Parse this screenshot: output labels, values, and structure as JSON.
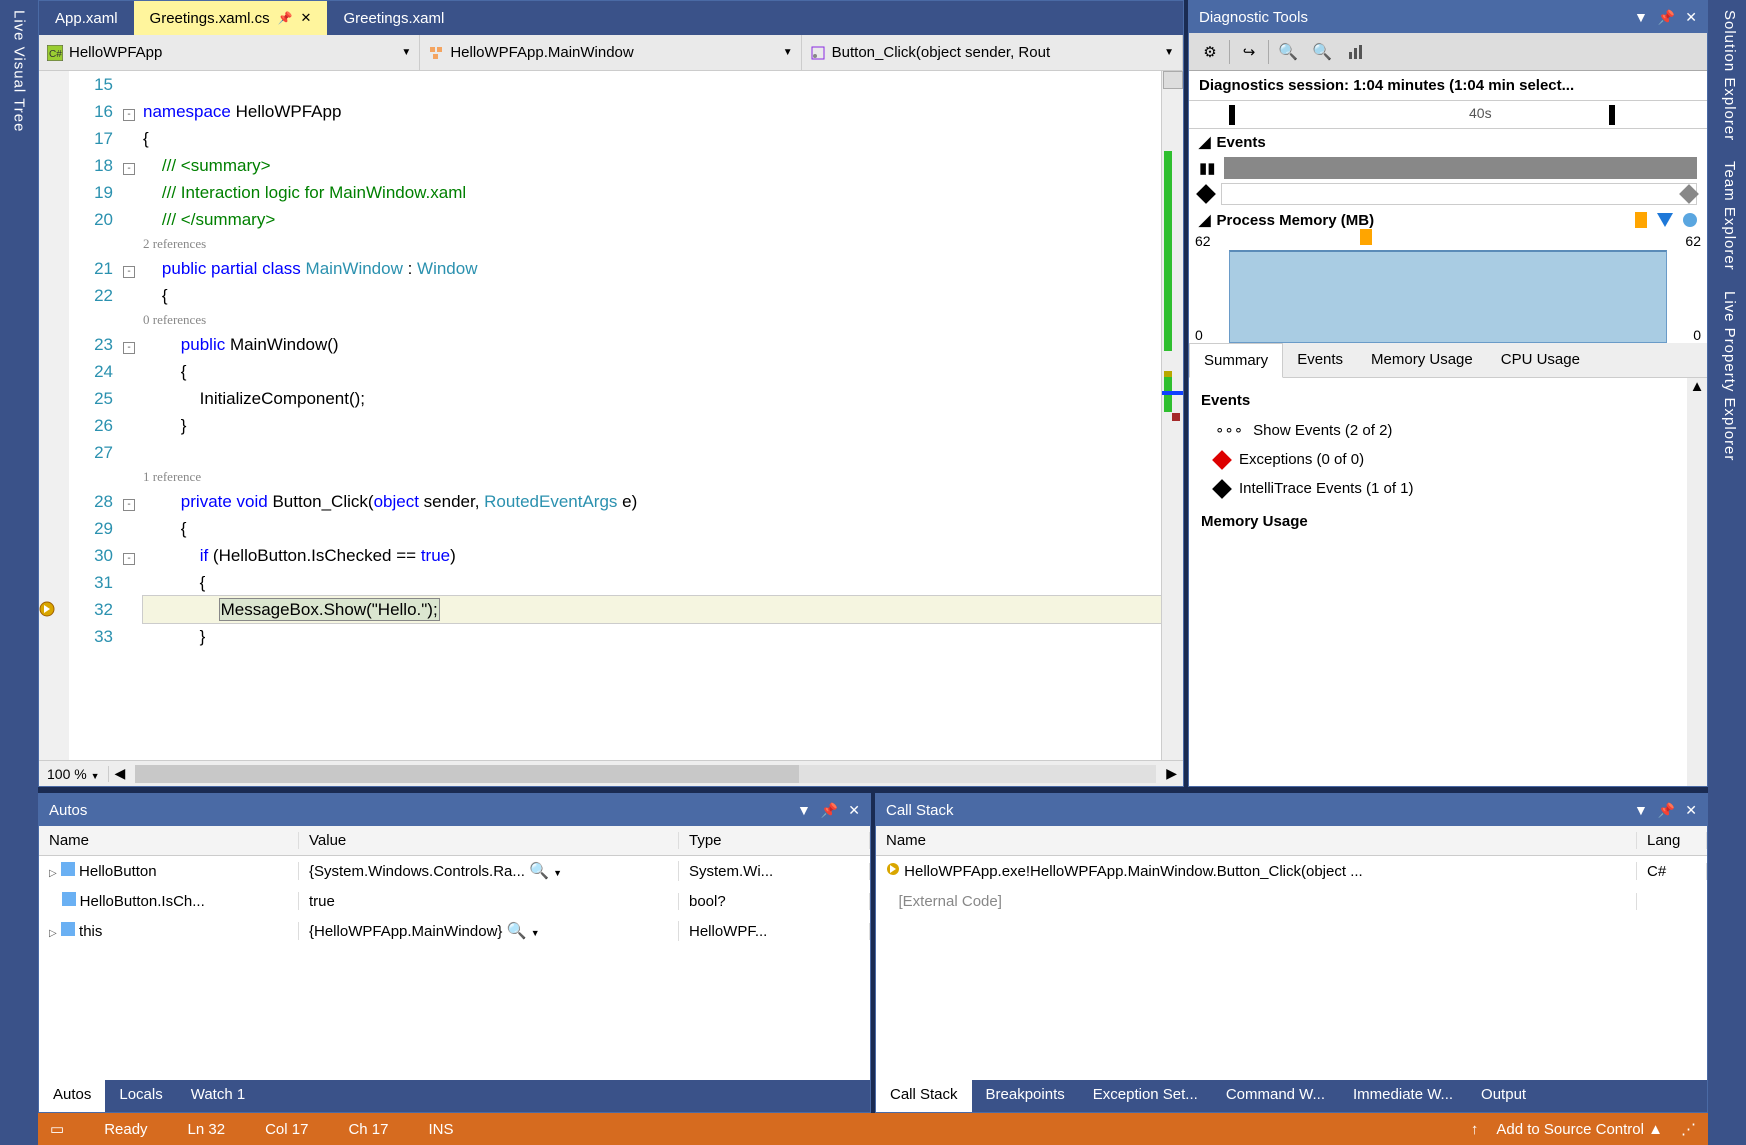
{
  "leftRail": "Live Visual Tree",
  "rightRail": [
    "Solution Explorer",
    "Team Explorer",
    "Live Property Explorer"
  ],
  "tabs": [
    {
      "label": "App.xaml",
      "active": false
    },
    {
      "label": "Greetings.xaml.cs",
      "active": true,
      "pinned": true
    },
    {
      "label": "Greetings.xaml",
      "active": false
    }
  ],
  "nav": {
    "namespace": "HelloWPFApp",
    "class": "HelloWPFApp.MainWindow",
    "member": "Button_Click(object sender, Rout"
  },
  "code": {
    "lines": [
      {
        "n": 15,
        "txt": ""
      },
      {
        "n": 16,
        "fold": "-",
        "txt": "namespace HelloWPFApp",
        "tokens": [
          [
            "kw",
            "namespace"
          ],
          [
            "",
            " HelloWPFApp"
          ]
        ]
      },
      {
        "n": 17,
        "txt": "{"
      },
      {
        "n": 18,
        "fold": "-",
        "txt": "    /// <summary>",
        "tokens": [
          [
            "",
            "    "
          ],
          [
            "comment",
            "/// <summary>"
          ]
        ]
      },
      {
        "n": 19,
        "txt": "    /// Interaction logic for MainWindow.xaml",
        "tokens": [
          [
            "",
            "    "
          ],
          [
            "comment",
            "/// Interaction logic for MainWindow.xaml"
          ]
        ]
      },
      {
        "n": 20,
        "txt": "    /// </summary>",
        "tokens": [
          [
            "",
            "    "
          ],
          [
            "comment",
            "/// </summary>"
          ]
        ]
      },
      {
        "ref": "2 references"
      },
      {
        "n": 21,
        "fold": "-",
        "tokens": [
          [
            "",
            "    "
          ],
          [
            "kw",
            "public partial class"
          ],
          [
            "",
            " "
          ],
          [
            "type",
            "MainWindow"
          ],
          [
            "",
            " : "
          ],
          [
            "type",
            "Window"
          ]
        ]
      },
      {
        "n": 22,
        "txt": "    {"
      },
      {
        "ref": "0 references"
      },
      {
        "n": 23,
        "fold": "-",
        "tokens": [
          [
            "",
            "        "
          ],
          [
            "kw",
            "public"
          ],
          [
            "",
            " MainWindow()"
          ]
        ]
      },
      {
        "n": 24,
        "txt": "        {"
      },
      {
        "n": 25,
        "txt": "            InitializeComponent();"
      },
      {
        "n": 26,
        "txt": "        }"
      },
      {
        "n": 27,
        "txt": ""
      },
      {
        "ref": "1 reference"
      },
      {
        "n": 28,
        "fold": "-",
        "tokens": [
          [
            "",
            "        "
          ],
          [
            "kw",
            "private void"
          ],
          [
            "",
            " Button_Click("
          ],
          [
            "kw",
            "object"
          ],
          [
            "",
            " sender, "
          ],
          [
            "type",
            "RoutedEventArgs"
          ],
          [
            "",
            " e)"
          ]
        ]
      },
      {
        "n": 29,
        "txt": "        {"
      },
      {
        "n": 30,
        "fold": "-",
        "tokens": [
          [
            "",
            "            "
          ],
          [
            "kw",
            "if"
          ],
          [
            "",
            " (HelloButton.IsChecked == "
          ],
          [
            "kw",
            "true"
          ],
          [
            "",
            ")"
          ]
        ]
      },
      {
        "n": 31,
        "txt": "            {"
      },
      {
        "n": 32,
        "bp": true,
        "highlight": true,
        "tokens": [
          [
            "",
            "                "
          ],
          [
            "sel",
            "MessageBox.Show(\"Hello.\");"
          ]
        ]
      },
      {
        "n": 33,
        "txt": "            }"
      }
    ],
    "zoom": "100 %"
  },
  "diag": {
    "title": "Diagnostic Tools",
    "session": "Diagnostics session: 1:04 minutes (1:04 min select...",
    "timeLabel": "40s",
    "eventsHeader": "Events",
    "memHeader": "Process Memory (MB)",
    "memMax": "62",
    "memMin": "0",
    "tabs": [
      "Summary",
      "Events",
      "Memory Usage",
      "CPU Usage"
    ],
    "activeTab": "Summary",
    "content": {
      "eventsTitle": "Events",
      "items": [
        {
          "icon": "dots",
          "label": "Show Events (2 of 2)"
        },
        {
          "icon": "red-diamond",
          "label": "Exceptions (0 of 0)"
        },
        {
          "icon": "black-diamond",
          "label": "IntelliTrace Events (1 of 1)"
        }
      ],
      "memTitle": "Memory Usage"
    }
  },
  "autos": {
    "title": "Autos",
    "cols": [
      "Name",
      "Value",
      "Type"
    ],
    "rows": [
      {
        "exp": true,
        "icon": true,
        "name": "HelloButton",
        "value": "{System.Windows.Controls.Ra...",
        "mag": true,
        "type": "System.Wi..."
      },
      {
        "exp": false,
        "icon": true,
        "name": "HelloButton.IsCh...",
        "value": "true",
        "type": "bool?"
      },
      {
        "exp": true,
        "icon": true,
        "name": "this",
        "value": "{HelloWPFApp.MainWindow}",
        "mag": true,
        "type": "HelloWPF..."
      }
    ],
    "tabs": [
      "Autos",
      "Locals",
      "Watch 1"
    ]
  },
  "callstack": {
    "title": "Call Stack",
    "cols": [
      "Name",
      "Lang"
    ],
    "rows": [
      {
        "arrow": true,
        "name": "HelloWPFApp.exe!HelloWPFApp.MainWindow.Button_Click(object ...",
        "lang": "C#"
      },
      {
        "name": "[External Code]",
        "gray": true
      }
    ],
    "tabs": [
      "Call Stack",
      "Breakpoints",
      "Exception Set...",
      "Command W...",
      "Immediate W...",
      "Output"
    ]
  },
  "status": {
    "ready": "Ready",
    "ln": "Ln 32",
    "col": "Col 17",
    "ch": "Ch 17",
    "ins": "INS",
    "source": "Add to Source Control"
  }
}
